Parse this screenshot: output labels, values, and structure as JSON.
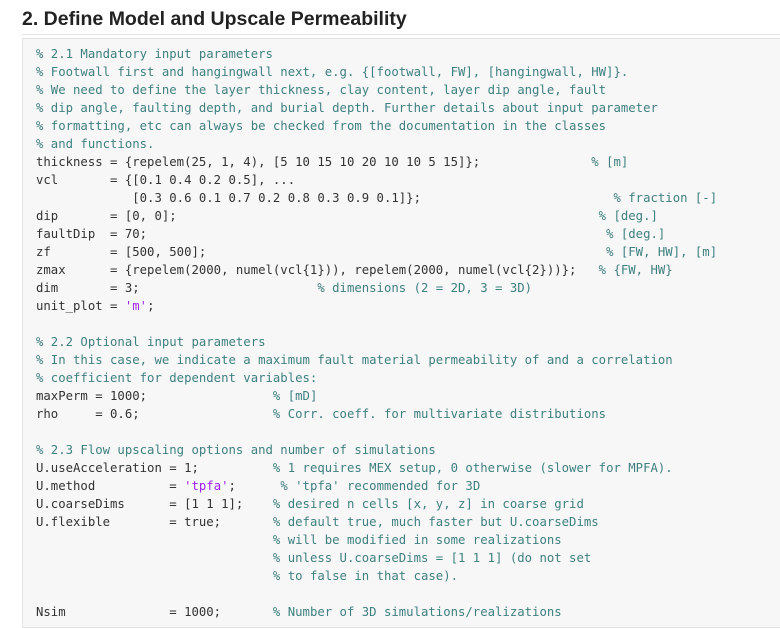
{
  "heading": "2. Define Model and Upscale Permeability",
  "code_lines": [
    [
      {
        "t": "% 2.1 Mandatory input parameters",
        "k": "c"
      }
    ],
    [
      {
        "t": "% Footwall first and hangingwall next, e.g. {[footwall, FW], [hangingwall, HW]}.",
        "k": "c"
      }
    ],
    [
      {
        "t": "% We need to define the layer thickness, clay content, layer dip angle, fault",
        "k": "c"
      }
    ],
    [
      {
        "t": "% dip angle, faulting depth, and burial depth. Further details about input parameter",
        "k": "c"
      }
    ],
    [
      {
        "t": "% formatting, etc can always be checked from the documentation in the classes",
        "k": "c"
      }
    ],
    [
      {
        "t": "% and functions.",
        "k": "c"
      }
    ],
    [
      {
        "t": "thickness = {repelem(25, 1, 4), [5 10 15 10 20 10 10 5 15]};               ",
        "k": ""
      },
      {
        "t": "% [m]",
        "k": "c"
      }
    ],
    [
      {
        "t": "vcl       = {[0.1 0.4 0.2 0.5], ...",
        "k": ""
      }
    ],
    [
      {
        "t": "             [0.3 0.6 0.1 0.7 0.2 0.8 0.3 0.9 0.1]};                          ",
        "k": ""
      },
      {
        "t": "% fraction [-]",
        "k": "c"
      }
    ],
    [
      {
        "t": "dip       = [0, 0];                                                         ",
        "k": ""
      },
      {
        "t": "% [deg.]",
        "k": "c"
      }
    ],
    [
      {
        "t": "faultDip  = 70;                                                              ",
        "k": ""
      },
      {
        "t": "% [deg.]",
        "k": "c"
      }
    ],
    [
      {
        "t": "zf        = [500, 500];                                                      ",
        "k": ""
      },
      {
        "t": "% [FW, HW], [m]",
        "k": "c"
      }
    ],
    [
      {
        "t": "zmax      = {repelem(2000, numel(vcl{1})), repelem(2000, numel(vcl{2}))};   ",
        "k": ""
      },
      {
        "t": "% {FW, HW}",
        "k": "c"
      }
    ],
    [
      {
        "t": "dim       = 3;                        ",
        "k": ""
      },
      {
        "t": "% dimensions (2 = 2D, 3 = 3D)",
        "k": "c"
      }
    ],
    [
      {
        "t": "unit_plot = ",
        "k": ""
      },
      {
        "t": "'m'",
        "k": "s"
      },
      {
        "t": ";",
        "k": ""
      }
    ],
    [],
    [
      {
        "t": "% 2.2 Optional input parameters",
        "k": "c"
      }
    ],
    [
      {
        "t": "% In this case, we indicate a maximum fault material permeability of and a correlation",
        "k": "c"
      }
    ],
    [
      {
        "t": "% coefficient for dependent variables:",
        "k": "c"
      }
    ],
    [
      {
        "t": "maxPerm = 1000;                 ",
        "k": ""
      },
      {
        "t": "% [mD]",
        "k": "c"
      }
    ],
    [
      {
        "t": "rho     = 0.6;                  ",
        "k": ""
      },
      {
        "t": "% Corr. coeff. for multivariate distributions",
        "k": "c"
      }
    ],
    [],
    [
      {
        "t": "% 2.3 Flow upscaling options and number of simulations",
        "k": "c"
      }
    ],
    [
      {
        "t": "U.useAcceleration = 1;          ",
        "k": ""
      },
      {
        "t": "% 1 requires MEX setup, 0 otherwise (slower for MPFA).",
        "k": "c"
      }
    ],
    [
      {
        "t": "U.method          = ",
        "k": ""
      },
      {
        "t": "'tpfa'",
        "k": "s"
      },
      {
        "t": ";      ",
        "k": ""
      },
      {
        "t": "% 'tpfa' recommended for 3D",
        "k": "c"
      }
    ],
    [
      {
        "t": "U.coarseDims      = [1 1 1];    ",
        "k": ""
      },
      {
        "t": "% desired n cells [x, y, z] in coarse grid",
        "k": "c"
      }
    ],
    [
      {
        "t": "U.flexible        = true;       ",
        "k": ""
      },
      {
        "t": "% default true, much faster but U.coarseDims",
        "k": "c"
      }
    ],
    [
      {
        "t": "                                ",
        "k": ""
      },
      {
        "t": "% will be modified in some realizations",
        "k": "c"
      }
    ],
    [
      {
        "t": "                                ",
        "k": ""
      },
      {
        "t": "% unless U.coarseDims = [1 1 1] (do not set",
        "k": "c"
      }
    ],
    [
      {
        "t": "                                ",
        "k": ""
      },
      {
        "t": "% to false in that case).",
        "k": "c"
      }
    ],
    [],
    [
      {
        "t": "Nsim              = 1000;       ",
        "k": ""
      },
      {
        "t": "% Number of 3D simulations/realizations",
        "k": "c"
      }
    ]
  ],
  "colors": {
    "comment": "#408080",
    "string": "#a020f0",
    "code": "#333333",
    "panel_bg": "#f7f7f7",
    "panel_border": "#e3e3e3"
  }
}
